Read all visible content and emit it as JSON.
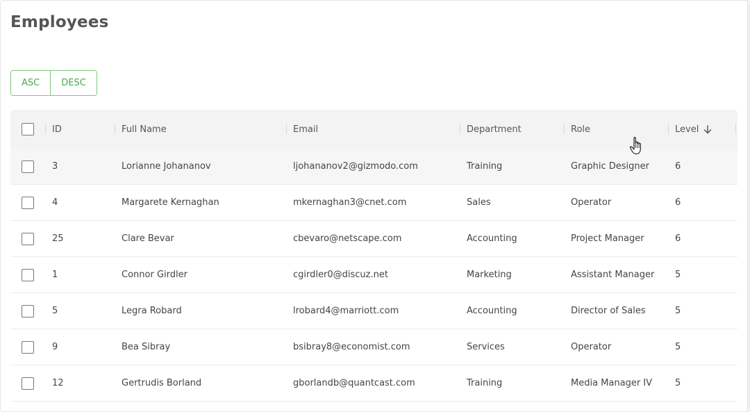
{
  "header": {
    "title": "Employees"
  },
  "sort": {
    "asc_label": "ASC",
    "desc_label": "DESC"
  },
  "table": {
    "columns": {
      "id": "ID",
      "full_name": "Full Name",
      "email": "Email",
      "department": "Department",
      "role": "Role",
      "level": "Level"
    },
    "sort_column": "Level",
    "sort_direction": "descending",
    "rows": [
      {
        "id": "3",
        "full_name": "Lorianne Johananov",
        "email": "ljohananov2@gizmodo.com",
        "department": "Training",
        "role": "Graphic Designer",
        "level": "6"
      },
      {
        "id": "4",
        "full_name": "Margarete Kernaghan",
        "email": "mkernaghan3@cnet.com",
        "department": "Sales",
        "role": "Operator",
        "level": "6"
      },
      {
        "id": "25",
        "full_name": "Clare Bevar",
        "email": "cbevaro@netscape.com",
        "department": "Accounting",
        "role": "Project Manager",
        "level": "6"
      },
      {
        "id": "1",
        "full_name": "Connor Girdler",
        "email": "cgirdler0@discuz.net",
        "department": "Marketing",
        "role": "Assistant Manager",
        "level": "5"
      },
      {
        "id": "5",
        "full_name": "Legra Robard",
        "email": "lrobard4@marriott.com",
        "department": "Accounting",
        "role": "Director of Sales",
        "level": "5"
      },
      {
        "id": "9",
        "full_name": "Bea Sibray",
        "email": "bsibray8@economist.com",
        "department": "Services",
        "role": "Operator",
        "level": "5"
      },
      {
        "id": "12",
        "full_name": "Gertrudis Borland",
        "email": "gborlandb@quantcast.com",
        "department": "Training",
        "role": "Media Manager IV",
        "level": "5"
      }
    ]
  },
  "icons": {
    "sort": "arrow-down-icon",
    "pointer": "hand-pointer-icon"
  },
  "colors": {
    "accent": "#4aa84a",
    "accent_border": "#7cc57a",
    "header_bg": "#f3f3f3"
  }
}
